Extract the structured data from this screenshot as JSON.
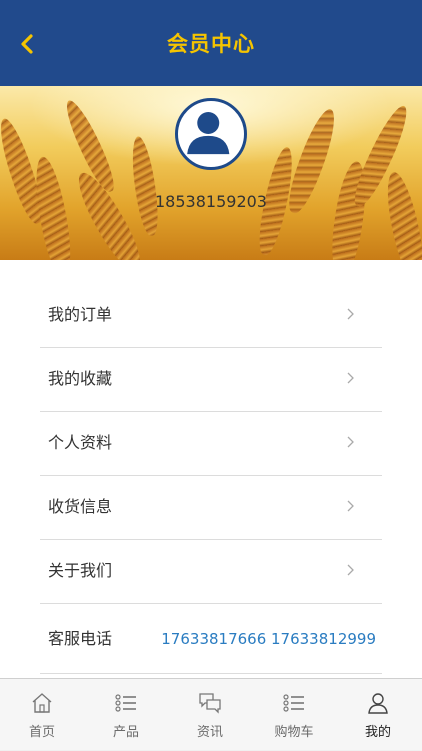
{
  "header": {
    "title": "会员中心"
  },
  "profile": {
    "phone": "18538159203"
  },
  "menu": [
    {
      "label": "我的订单"
    },
    {
      "label": "我的收藏"
    },
    {
      "label": "个人资料"
    },
    {
      "label": "收货信息"
    },
    {
      "label": "关于我们"
    }
  ],
  "service": {
    "label": "客服电话",
    "numbers": "17633817666 17633812999"
  },
  "tabs": [
    {
      "label": "首页",
      "icon": "home-icon"
    },
    {
      "label": "产品",
      "icon": "list-icon"
    },
    {
      "label": "资讯",
      "icon": "chat-icon"
    },
    {
      "label": "购物车",
      "icon": "list-icon"
    },
    {
      "label": "我的",
      "icon": "user-icon"
    }
  ],
  "colors": {
    "header_bg": "#214a8c",
    "title": "#f5c400",
    "link": "#2a7cc1"
  }
}
